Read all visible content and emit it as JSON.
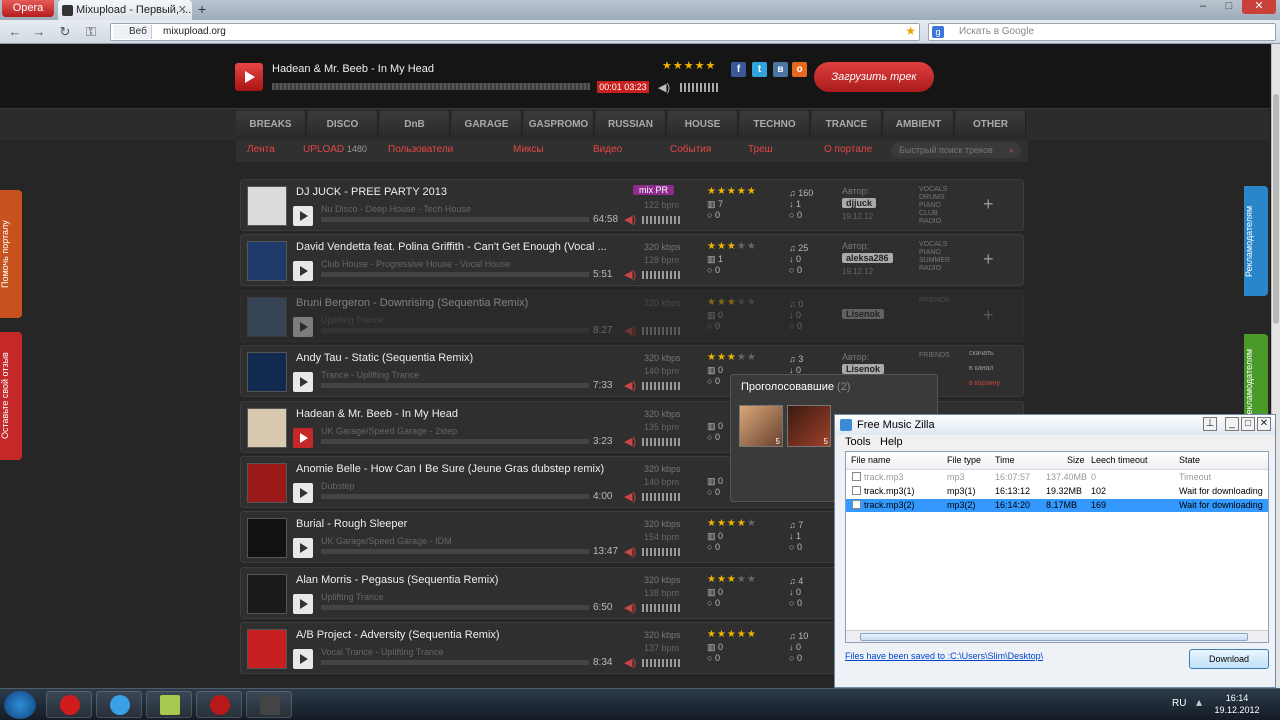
{
  "browser": {
    "menu_label": "Opera",
    "tab_title": "Mixupload - Первый, ...",
    "url_badge": "Веб",
    "url": "mixupload.org",
    "search_placeholder": "Искать в Google"
  },
  "player": {
    "now_playing": "Hadean & Mr. Beeb - In My Head",
    "time": "00:01 03:23",
    "rating_stars": 5,
    "upload_button": "Загрузить трек"
  },
  "genres": [
    "BREAKS",
    "DISCO",
    "DnB",
    "GARAGE",
    "GASPROMO",
    "RUSSIAN",
    "HOUSE",
    "TECHNO",
    "TRANCE",
    "AMBIENT",
    "OTHER"
  ],
  "subnav": {
    "items": [
      "Лента",
      "UPLOAD",
      "Пользователи",
      "Миксы",
      "Видео",
      "События",
      "Треш",
      "О портале"
    ],
    "upload_count": "1480",
    "search_placeholder": "Быстрый поиск треков"
  },
  "side_tabs": {
    "left_top": "Помочь порталу",
    "left_bottom": "Оставьте свой отзыв",
    "right_top": "Рекламодателям",
    "right_bottom": "Рекламодателям"
  },
  "tracks": [
    {
      "title": "DJ JUCK - PREE PARTY 2013",
      "tags": "Nu Disco  -  Deep House  -  Tech House",
      "duration": "64:58",
      "badge": "mix PR",
      "kbps": "",
      "bpm": "122 bpm",
      "stars": 5,
      "plays": "160",
      "downloads": "1",
      "comments": "0",
      "likes": "7",
      "reposts": "0",
      "author_label": "Автор:",
      "author": "djjuck",
      "date": "19.12.12",
      "genre_tags": "VOCALS DRUMS PIANO CLUB RADIO"
    },
    {
      "title": "David Vendetta feat. Polina Griffith - Can't Get Enough (Vocal ...",
      "tags": "Club House  -  Progressive House  -  Vocal House",
      "duration": "5:51",
      "badge": "",
      "kbps": "320 kbps",
      "bpm": "128 bpm",
      "stars": 3,
      "plays": "25",
      "downloads": "0",
      "comments": "0",
      "likes": "1",
      "reposts": "0",
      "author_label": "Автор:",
      "author": "aleksa286",
      "date": "19.12.12",
      "genre_tags": "VOCALS PIANO SUMMER RADIO"
    },
    {
      "title": "Bruni Bergeron - Downrising (Sequentia Remix)",
      "tags": "Uplifting Trance",
      "duration": "8:27",
      "badge": "",
      "kbps": "320 kbps",
      "bpm": "",
      "stars": 3,
      "plays": "0",
      "downloads": "0",
      "comments": "0",
      "likes": "0",
      "reposts": "0",
      "author_label": "",
      "author": "Lisenok",
      "date": "",
      "genre_tags": "FRIENDS"
    },
    {
      "title": "Andy Tau - Static (Sequentia Remix)",
      "tags": "Trance  -  Uplifting Trance",
      "duration": "7:33",
      "badge": "",
      "kbps": "320 kbps",
      "bpm": "140 bpm",
      "stars": 3,
      "plays": "3",
      "downloads": "0",
      "comments": "0",
      "likes": "0",
      "reposts": "0",
      "author_label": "Автор:",
      "author": "Lisenok",
      "date": "",
      "genre_tags": "FRIENDS"
    },
    {
      "title": "Hadean & Mr. Beeb - In My Head",
      "tags": "UK Garage/Speed Garage  -  2step",
      "duration": "3:23",
      "badge": "",
      "kbps": "320 kbps",
      "bpm": "135 bpm",
      "stars": 0,
      "plays": "",
      "downloads": "",
      "comments": "0",
      "likes": "0",
      "reposts": "0",
      "author_label": "",
      "author": "",
      "date": "",
      "genre_tags": ""
    },
    {
      "title": "Anomie Belle - How Can I Be Sure (Jeune Gras dubstep remix)",
      "tags": "Dubstep",
      "duration": "4:00",
      "badge": "",
      "kbps": "320 kbps",
      "bpm": "140 bpm",
      "stars": 0,
      "plays": "",
      "downloads": "",
      "comments": "0",
      "likes": "0",
      "reposts": "0",
      "author_label": "",
      "author": "",
      "date": "",
      "genre_tags": ""
    },
    {
      "title": "Burial - Rough Sleeper",
      "tags": "UK Garage/Speed Garage  -  IDM",
      "duration": "13:47",
      "badge": "",
      "kbps": "320 kbps",
      "bpm": "154 bpm",
      "stars": 4,
      "plays": "7",
      "downloads": "1",
      "comments": "0",
      "likes": "0",
      "reposts": "0",
      "author_label": "",
      "author": "",
      "date": "",
      "genre_tags": ""
    },
    {
      "title": "Alan Morris - Pegasus (Sequentia Remix)",
      "tags": "Uplifting Trance",
      "duration": "6:50",
      "badge": "",
      "kbps": "320 kbps",
      "bpm": "138 bpm",
      "stars": 3,
      "plays": "4",
      "downloads": "0",
      "comments": "0",
      "likes": "0",
      "reposts": "0",
      "author_label": "",
      "author": "",
      "date": "",
      "genre_tags": ""
    },
    {
      "title": "A/B Project - Adversity (Sequentia Remix)",
      "tags": "Vocal Trance  -  Uplifting Trance",
      "duration": "8:34",
      "badge": "",
      "kbps": "320 kbps",
      "bpm": "137 bpm",
      "stars": 5,
      "plays": "10",
      "downloads": "0",
      "comments": "0",
      "likes": "0",
      "reposts": "0",
      "author_label": "",
      "author": "",
      "date": "",
      "genre_tags": ""
    }
  ],
  "track4_actions": [
    "скачать",
    "в канал",
    "в корзину"
  ],
  "voters": {
    "title": "Проголосовавшие",
    "count": "(2)",
    "ratings": [
      "5",
      "5"
    ]
  },
  "fmz": {
    "title": "Free Music Zilla",
    "menu": [
      "Tools",
      "Help"
    ],
    "columns": [
      "File name",
      "File type",
      "Time",
      "Size",
      "Leech timeout",
      "State"
    ],
    "rows": [
      {
        "name": "track.mp3",
        "type": "mp3",
        "time": "16:07:57",
        "size": "137.40MB",
        "leech": "0",
        "state": "Timeout",
        "checked": false,
        "selected": false,
        "grey": true
      },
      {
        "name": "track.mp3(1)",
        "type": "mp3(1)",
        "time": "16:13:12",
        "size": "19.32MB",
        "leech": "102",
        "state": "Wait for downloading",
        "checked": false,
        "selected": false,
        "grey": false
      },
      {
        "name": "track.mp3(2)",
        "type": "mp3(2)",
        "time": "16:14:20",
        "size": "8.17MB",
        "leech": "169",
        "state": "Wait for downloading",
        "checked": true,
        "selected": true,
        "grey": false
      }
    ],
    "saved_link": "Files have been saved to :C:\\Users\\Slim\\Desktop\\",
    "download_button": "Download"
  },
  "taskbar": {
    "lang": "RU",
    "time": "16:14",
    "date": "19.12.2012"
  },
  "colors": {
    "accent_red": "#c92020",
    "star": "#f2b400",
    "selection": "#3399ff"
  }
}
